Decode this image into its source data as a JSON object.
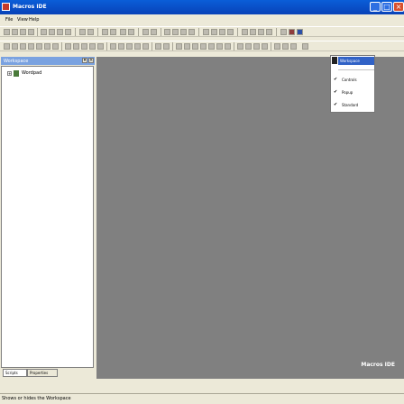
{
  "window": {
    "title": "Macros IDE"
  },
  "menu": {
    "items": [
      "File",
      "View",
      "Help"
    ]
  },
  "panel": {
    "title": "Workspace",
    "tree": [
      {
        "label": "Wordpad"
      }
    ],
    "tabs": [
      "Scripts",
      "Properties"
    ]
  },
  "dropdown": {
    "header": "Workspace",
    "items": [
      {
        "label": "Controls",
        "checked": true
      },
      {
        "label": "Popup",
        "checked": true
      },
      {
        "label": "Standard",
        "checked": true
      }
    ]
  },
  "workspace": {
    "watermark": "Macros IDE"
  },
  "status": {
    "text": "Shows or hides the Workspace"
  }
}
